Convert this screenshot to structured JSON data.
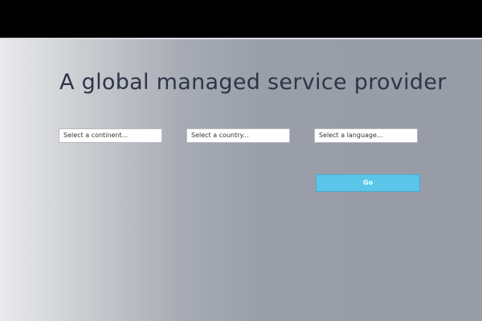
{
  "hero": {
    "title": "A global managed service provider"
  },
  "form": {
    "continent": {
      "selected": "Select a continent..."
    },
    "country": {
      "selected": "Select a country..."
    },
    "language": {
      "selected": "Select a language..."
    },
    "go_label": "Go"
  },
  "colors": {
    "accent": "#5bc5ea",
    "title_text": "#2f3548",
    "header_background": "#000000"
  }
}
